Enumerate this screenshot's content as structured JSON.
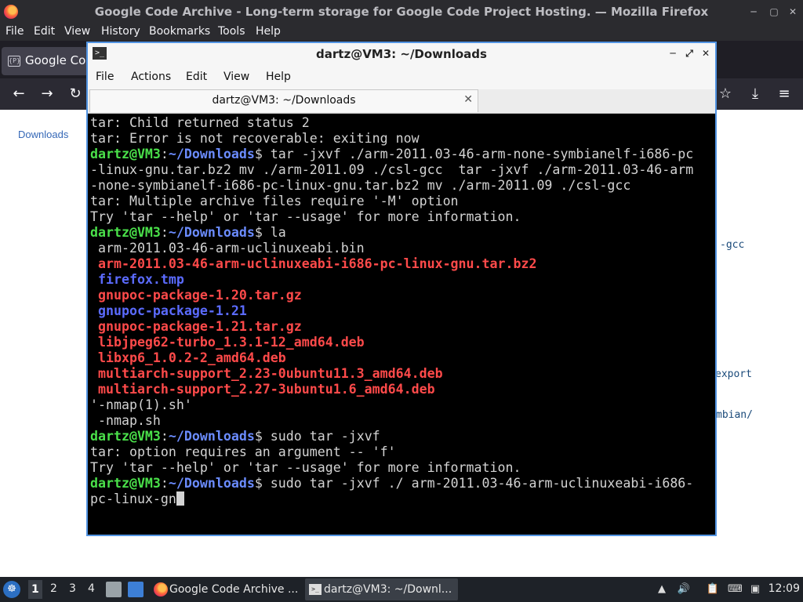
{
  "firefox": {
    "window_title": "Google Code Archive - Long-term storage for Google Code Project Hosting. — Mozilla Firefox",
    "menu": [
      "File",
      "Edit",
      "View",
      "History",
      "Bookmarks",
      "Tools",
      "Help"
    ],
    "tab_label": "Google Code Archive - Long-term storage for Google Code Project Hosting.",
    "tab_icon_text": "{P}",
    "page": {
      "downloads_link": "Downloads",
      "fragments": [
        "-gcc",
        "export",
        "mbian/"
      ]
    }
  },
  "terminal": {
    "window_title": "dartz@VM3: ~/Downloads",
    "menu": [
      "File",
      "Actions",
      "Edit",
      "View",
      "Help"
    ],
    "tab_label": "dartz@VM3: ~/Downloads",
    "prompt_user": "dartz@VM3",
    "prompt_path": "~/Downloads",
    "lines": [
      {
        "k": "out",
        "t": "tar: Child returned status 2"
      },
      {
        "k": "out",
        "t": "tar: Error is not recoverable: exiting now"
      },
      {
        "k": "cmd",
        "t": " tar -jxvf ./arm-2011.03-46-arm-none-symbianelf-i686-pc"
      },
      {
        "k": "out",
        "t": "-linux-gnu.tar.bz2 mv ./arm-2011.09 ./csl-gcc  tar -jxvf ./arm-2011.03-46-arm"
      },
      {
        "k": "out",
        "t": "-none-symbianelf-i686-pc-linux-gnu.tar.bz2 mv ./arm-2011.09 ./csl-gcc"
      },
      {
        "k": "out",
        "t": "tar: Multiple archive files require '-M' option"
      },
      {
        "k": "out",
        "t": "Try 'tar --help' or 'tar --usage' for more information."
      },
      {
        "k": "cmd",
        "t": " la"
      },
      {
        "k": "out",
        "t": " arm-2011.03-46-arm-uclinuxeabi.bin"
      },
      {
        "k": "red",
        "t": " arm-2011.03-46-arm-uclinuxeabi-i686-pc-linux-gnu.tar.bz2"
      },
      {
        "k": "blue",
        "t": " firefox.tmp"
      },
      {
        "k": "red",
        "t": " gnupoc-package-1.20.tar.gz"
      },
      {
        "k": "blue",
        "t": " gnupoc-package-1.21"
      },
      {
        "k": "red",
        "t": " gnupoc-package-1.21.tar.gz"
      },
      {
        "k": "red",
        "t": " libjpeg62-turbo_1.3.1-12_amd64.deb"
      },
      {
        "k": "red",
        "t": " libxp6_1.0.2-2_amd64.deb"
      },
      {
        "k": "red",
        "t": " multiarch-support_2.23-0ubuntu11.3_amd64.deb"
      },
      {
        "k": "red",
        "t": " multiarch-support_2.27-3ubuntu1.6_amd64.deb"
      },
      {
        "k": "out",
        "t": "'-nmap(1).sh'"
      },
      {
        "k": "out",
        "t": " -nmap.sh"
      },
      {
        "k": "cmd",
        "t": " sudo tar -jxvf"
      },
      {
        "k": "out",
        "t": "tar: option requires an argument -- 'f'"
      },
      {
        "k": "out",
        "t": "Try 'tar --help' or 'tar --usage' for more information."
      },
      {
        "k": "cmd",
        "t": " sudo tar -jxvf ./ arm-2011.03-46-arm-uclinuxeabi-i686-"
      },
      {
        "k": "cursor",
        "t": "pc-linux-gn"
      }
    ]
  },
  "taskbar": {
    "workspaces": [
      "1",
      "2",
      "3",
      "4"
    ],
    "tasks": [
      {
        "label": "Google Code Archive ..."
      },
      {
        "label": "dartz@VM3: ~/Downl..."
      }
    ],
    "clock": "12:09"
  },
  "colors": {
    "terminal_user": "#4ae04a",
    "terminal_path": "#6b8cff",
    "archive_red": "#ff4a4a",
    "dir_blue": "#5b6bff",
    "window_focus_border": "#5294e2"
  },
  "icons": [
    "firefox-icon",
    "back-icon",
    "forward-icon",
    "reload-icon",
    "bookmark-star-icon",
    "download-icon",
    "hamburger-menu-icon",
    "terminal-icon",
    "minimize-icon",
    "maximize-icon",
    "close-icon",
    "start-menu-icon",
    "volume-icon",
    "network-icon",
    "clipboard-icon"
  ]
}
